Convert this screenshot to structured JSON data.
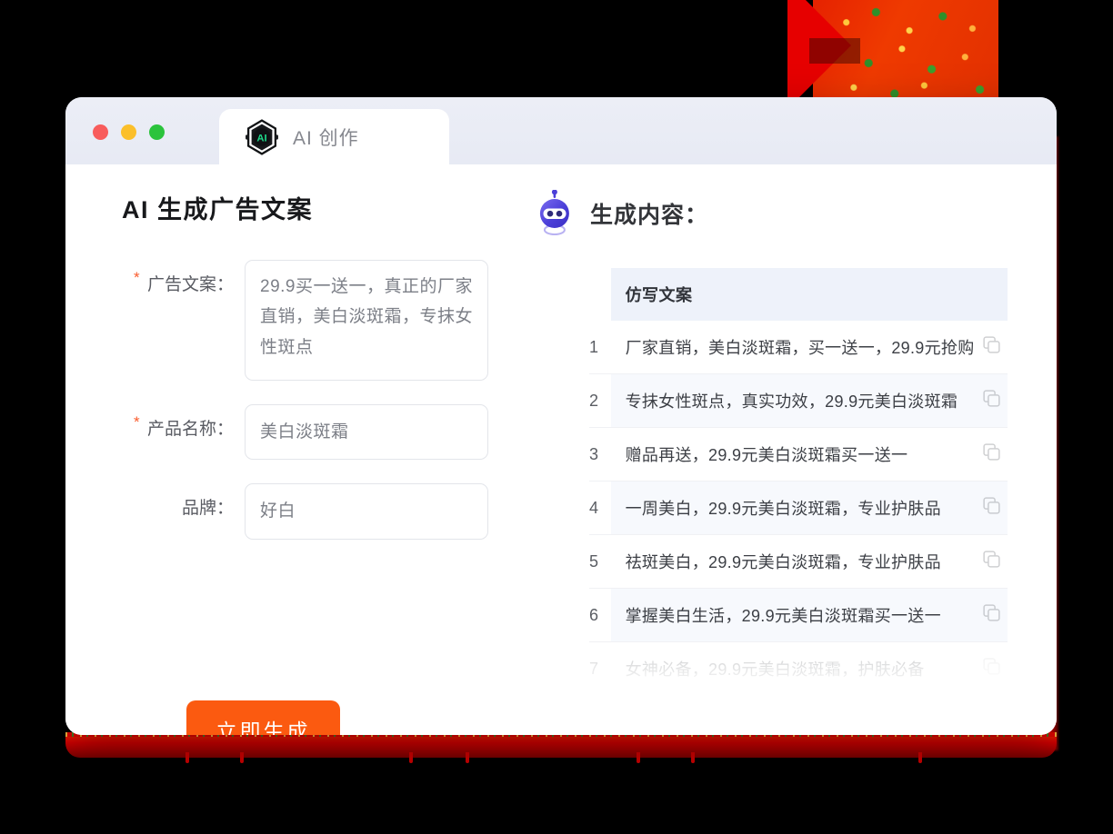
{
  "window": {
    "traffic_lights": [
      {
        "name": "close",
        "color": "#f85c5c"
      },
      {
        "name": "minimize",
        "color": "#fbbf2b"
      },
      {
        "name": "maximize",
        "color": "#2bc33c"
      }
    ],
    "tab": {
      "label": "AI 创作",
      "icon": "ai-hexagon-icon",
      "icon_text": "AI"
    }
  },
  "left": {
    "title": "AI 生成广告文案",
    "fields": [
      {
        "label": "广告文案：",
        "required": true,
        "value": "29.9买一送一，真正的厂家直销，美白淡斑霜，专抹女性斑点",
        "type": "textarea"
      },
      {
        "label": "产品名称：",
        "required": true,
        "value": "美白淡斑霜",
        "type": "text"
      },
      {
        "label": "品牌：",
        "required": false,
        "value": "好白",
        "type": "text"
      }
    ],
    "generate_button": "立即生成"
  },
  "right": {
    "title": "生成内容：",
    "icon": "robot-icon",
    "table": {
      "columns": [
        "",
        "仿写文案",
        ""
      ],
      "header_label": "仿写文案",
      "rows": [
        {
          "index": "1",
          "text": "厂家直销，美白淡斑霜，买一送一，29.9元抢购",
          "action_icon": "copy-icon"
        },
        {
          "index": "2",
          "text": "专抹女性斑点，真实功效，29.9元美白淡斑霜",
          "action_icon": "copy-icon"
        },
        {
          "index": "3",
          "text": "赠品再送，29.9元美白淡斑霜买一送一",
          "action_icon": "copy-icon"
        },
        {
          "index": "4",
          "text": "一周美白，29.9元美白淡斑霜，专业护肤品",
          "action_icon": "copy-icon"
        },
        {
          "index": "5",
          "text": "祛斑美白，29.9元美白淡斑霜，专业护肤品",
          "action_icon": "copy-icon"
        },
        {
          "index": "6",
          "text": "掌握美白生活，29.9元美白淡斑霜买一送一",
          "action_icon": "copy-icon"
        },
        {
          "index": "7",
          "text": "女神必备，29.9元美白淡斑霜，护肤必备",
          "action_icon": "copy-icon"
        }
      ]
    }
  },
  "colors": {
    "accent_orange": "#fb5a10",
    "required_star": "#fa5c2e",
    "titlebar": "#e9ecf5",
    "table_header": "#eef2fa",
    "row_alt": "#f7f9fd",
    "robot_purple": "#4b3fd8",
    "decoration_red": "#e62200"
  }
}
